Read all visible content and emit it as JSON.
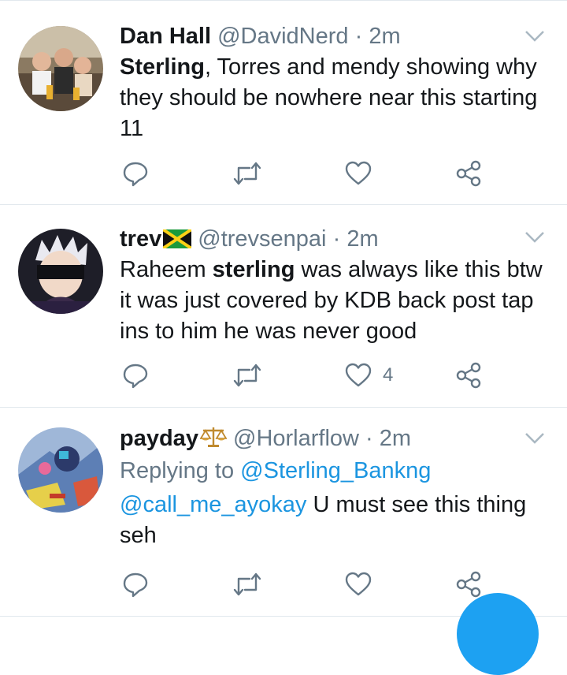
{
  "tweets": [
    {
      "name": "Dan Hall",
      "handle": "@DavidNerd",
      "separator": "·",
      "time": "2m",
      "text_bold_1": "Sterling",
      "text_rest_1": ", Torres and mendy showing why they should be nowhere near this starting 11",
      "avatar": "group-photo-avatar",
      "likes": ""
    },
    {
      "name": "trev",
      "name_emoji": "jamaica-flag",
      "handle": "@trevsenpai",
      "separator": "·",
      "time": "2m",
      "text_start": "Raheem ",
      "text_bold": "sterling",
      "text_end": " was always like this btw it was just covered by KDB back post tap ins to him he was never good",
      "avatar": "anime-character-avatar",
      "likes": "4"
    },
    {
      "name": "payday",
      "name_emoji": "balance-scale",
      "handle": "@Horlarflow",
      "separator": "·",
      "time": "2m",
      "replying_label": "Replying to",
      "replying_to": "@Sterling_Bankng",
      "mention": "@call_me_ayokay",
      "text": " U must see this thing seh",
      "avatar": "abstract-art-avatar",
      "likes": ""
    }
  ],
  "colors": {
    "link": "#1b95e0",
    "muted": "#657786",
    "text": "#14171a",
    "fab": "#1da1f2",
    "divider": "#e1e8ed"
  },
  "icons": [
    "reply-icon",
    "retweet-icon",
    "like-icon",
    "share-icon",
    "chevron-down-icon"
  ]
}
